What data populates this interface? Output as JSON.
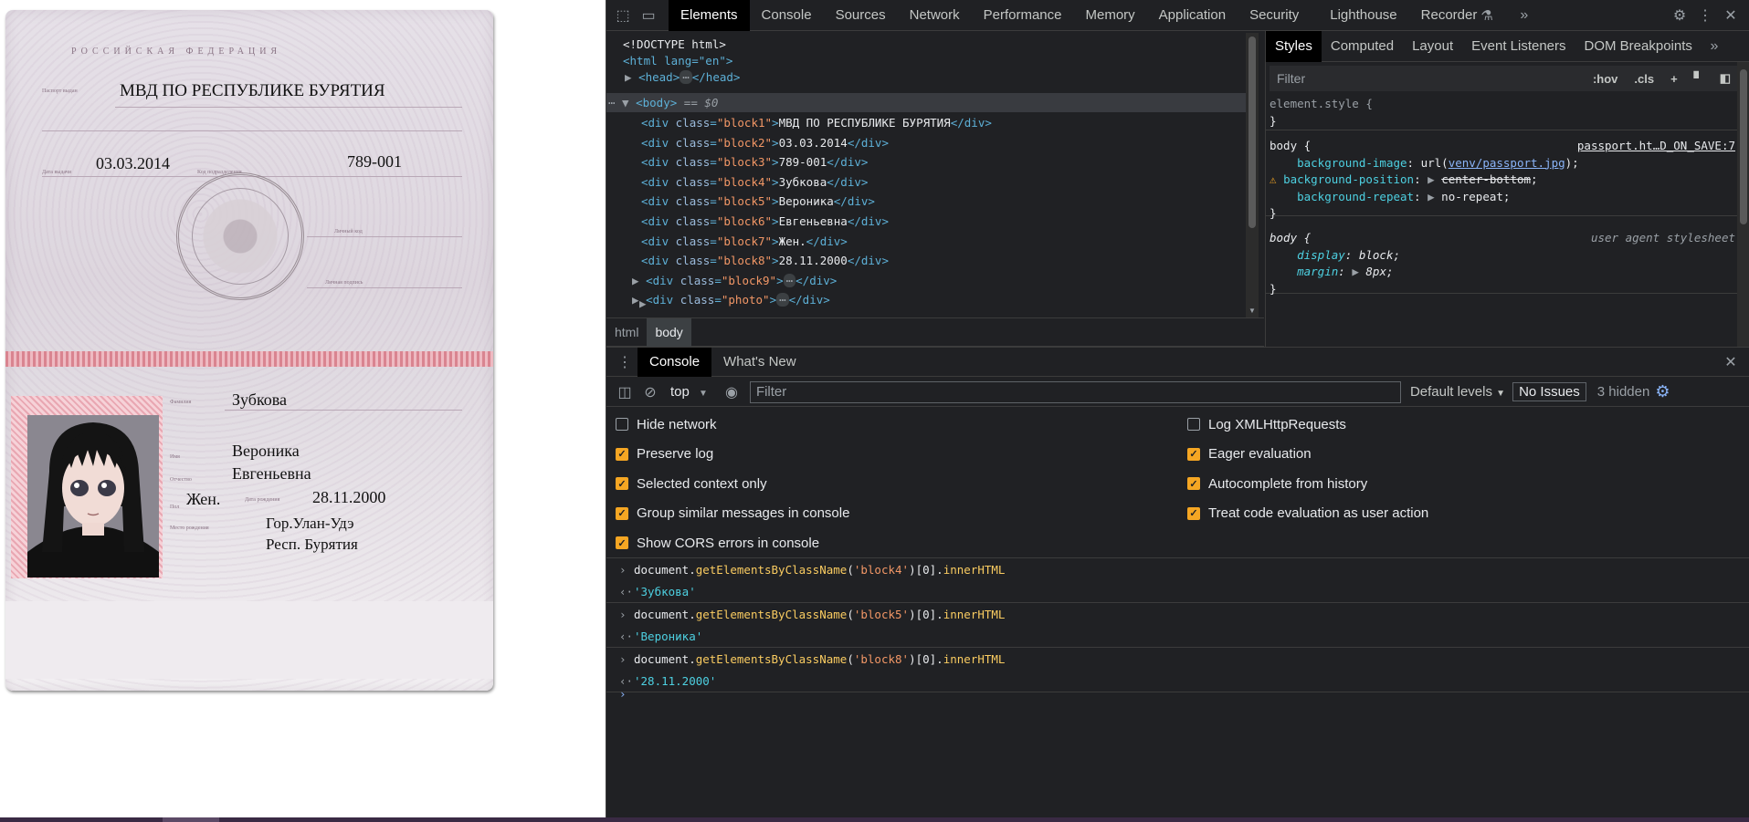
{
  "passport": {
    "country": "РОССИЙСКАЯ ФЕДЕРАЦИЯ",
    "issued_by": "МВД ПО РЕСПУБЛИКЕ БУРЯТИЯ",
    "issue_date": "03.03.2014",
    "division_code": "789-001",
    "surname": "Зубкова",
    "name": "Вероника",
    "patronymic": "Евгеньевна",
    "sex": "Жен.",
    "birth_date": "28.11.2000",
    "birth_place_1": "Гор.Улан-Удэ",
    "birth_place_2": "Респ. Бурятия"
  },
  "devtools": {
    "tabs": [
      "Elements",
      "Console",
      "Sources",
      "Network",
      "Performance",
      "Memory",
      "Application",
      "Security",
      "Lighthouse",
      "Recorder"
    ],
    "active_tab": "Elements",
    "dom": {
      "doctype": "<!DOCTYPE html>",
      "html_open": "<html lang=\"en\">",
      "head": "<head>",
      "head_close": "</head>",
      "body": "<body>",
      "body_marker": " == $0",
      "rows": [
        {
          "cls": "block1",
          "text": "МВД ПО РЕСПУБЛИКЕ БУРЯТИЯ"
        },
        {
          "cls": "block2",
          "text": "03.03.2014"
        },
        {
          "cls": "block3",
          "text": "789-001"
        },
        {
          "cls": "block4",
          "text": "Зубкова"
        },
        {
          "cls": "block5",
          "text": "Вероника"
        },
        {
          "cls": "block6",
          "text": "Евгеньевна"
        },
        {
          "cls": "block7",
          "text": "Жен."
        },
        {
          "cls": "block8",
          "text": "28.11.2000"
        }
      ],
      "collapsed": [
        "block9",
        "photo"
      ]
    },
    "breadcrumbs": [
      "html",
      "body"
    ],
    "styles_tabs": [
      "Styles",
      "Computed",
      "Layout",
      "Event Listeners",
      "DOM Breakpoints"
    ],
    "styles_filter_placeholder": "Filter",
    "hov": ":hov",
    "cls": ".cls",
    "element_style": "element.style {",
    "close_brace": "}",
    "body_rule_selector": "body {",
    "body_rule_source": "passport.ht…D_ON_SAVE:7",
    "body_rule_props": [
      {
        "name": "background-image",
        "value": "url(",
        "link": "venv/passport.jpg",
        "after": ");"
      },
      {
        "name": "background-position",
        "value": "center-bottom",
        "after": ";"
      },
      {
        "name": "background-repeat",
        "value": "no-repeat",
        "after": ";"
      }
    ],
    "ua_selector": "body {",
    "ua_source": "user agent stylesheet",
    "ua_props": [
      {
        "name": "display",
        "value": "block;"
      },
      {
        "name": "margin",
        "value": "8px;"
      }
    ],
    "drawer_tabs": [
      "Console",
      "What's New"
    ],
    "context": "top",
    "console_filter_placeholder": "Filter",
    "levels": "Default levels",
    "issues": "No Issues",
    "hidden": "3 hidden",
    "settings_left": [
      {
        "label": "Hide network",
        "checked": false
      },
      {
        "label": "Preserve log",
        "checked": true
      },
      {
        "label": "Selected context only",
        "checked": true
      },
      {
        "label": "Group similar messages in console",
        "checked": true
      },
      {
        "label": "Show CORS errors in console",
        "checked": true
      }
    ],
    "settings_right": [
      {
        "label": "Log XMLHttpRequests",
        "checked": false
      },
      {
        "label": "Eager evaluation",
        "checked": true
      },
      {
        "label": "Autocomplete from history",
        "checked": true
      },
      {
        "label": "Treat code evaluation as user action",
        "checked": true
      }
    ],
    "console": [
      {
        "cls": "block4",
        "result": "'Зубкова'"
      },
      {
        "cls": "block5",
        "result": "'Вероника'"
      },
      {
        "cls": "block8",
        "result": "'28.11.2000'"
      }
    ],
    "console_code": {
      "obj": "document.",
      "fn": "getElementsByClassName",
      "open": "(",
      "close": ")[0].",
      "prop": "innerHTML"
    }
  },
  "colors": {
    "accent": "#f5a623",
    "tag": "#5db0d7",
    "attr_value": "#f29766"
  }
}
